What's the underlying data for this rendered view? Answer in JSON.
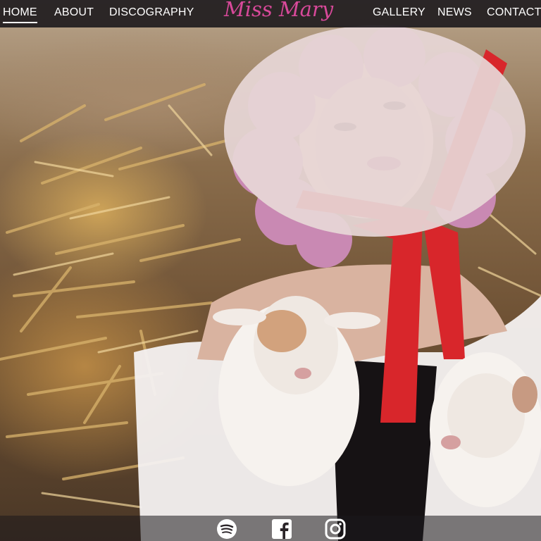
{
  "nav": {
    "home": "HOME",
    "about": "ABOUT",
    "discography": "DISCOGRAPHY",
    "gallery": "GALLERY",
    "news": "NEWS",
    "contact": "CONTACT"
  },
  "logo": {
    "text": "Miss Mary"
  },
  "hero": {
    "alt": "Photo of a woman with curly pink hair in a white bonnet tied with a red ribbon, holding two white goat kids in front of a pile of straw"
  },
  "social": {
    "spotify_icon": "spotify-icon",
    "facebook_icon": "facebook-icon",
    "instagram_icon": "instagram-icon"
  },
  "colors": {
    "logo": "#d8499a",
    "nav_bg": "#1c181c",
    "ribbon": "#d8262b",
    "hair": "#c989b3"
  }
}
